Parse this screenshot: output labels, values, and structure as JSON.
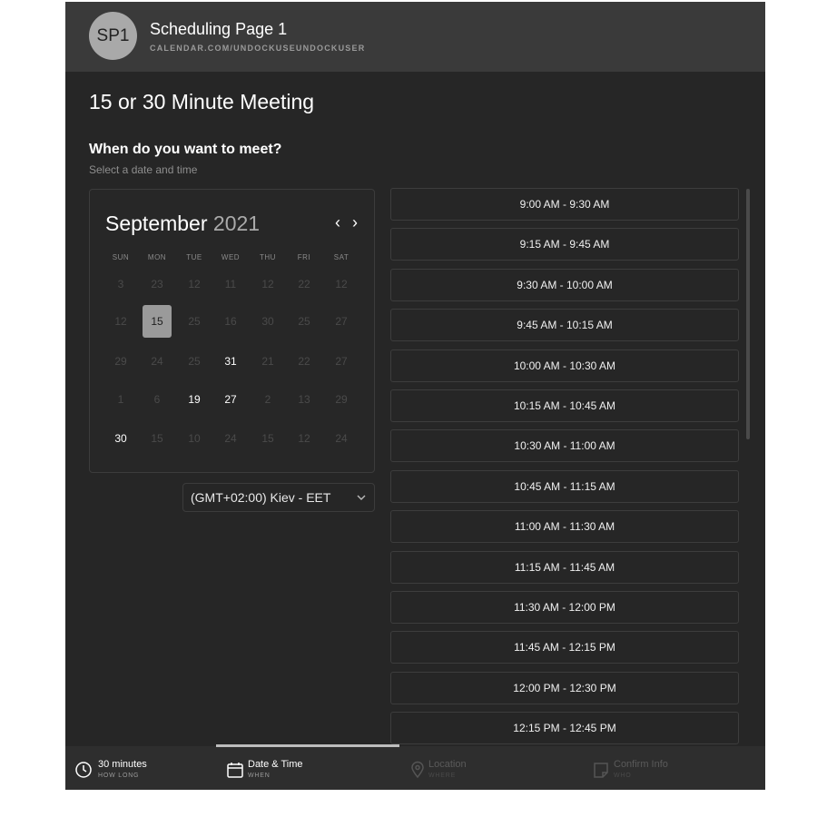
{
  "header": {
    "avatar_text": "SP1",
    "page_name": "Scheduling Page 1",
    "page_url": "CALENDAR.COM/UNDOCKUSEUNDOCKUSER"
  },
  "meeting_title": "15 or 30 Minute Meeting",
  "question": "When do you want to meet?",
  "subquestion": "Select a date and time",
  "calendar": {
    "month": "September",
    "year": "2021",
    "prev_icon": "‹",
    "next_icon": "›",
    "weekdays": [
      "SUN",
      "MON",
      "TUE",
      "WED",
      "THU",
      "FRI",
      "SAT"
    ],
    "weeks": [
      [
        "3",
        "23",
        "12",
        "11",
        "12",
        "22",
        "12"
      ],
      [
        "12",
        "15",
        "25",
        "16",
        "30",
        "25",
        "27"
      ],
      [
        "29",
        "24",
        "25",
        "31",
        "21",
        "22",
        "27"
      ],
      [
        "1",
        "6",
        "19",
        "27",
        "2",
        "13",
        "29"
      ],
      [
        "30",
        "15",
        "10",
        "24",
        "15",
        "12",
        "24"
      ]
    ],
    "selected_day": "15"
  },
  "timezone": {
    "value": "(GMT+02:00) Kiev - EET",
    "chevron": "⌄"
  },
  "time_slots": [
    "9:00 AM - 9:30 AM",
    "9:15 AM - 9:45 AM",
    "9:30 AM - 10:00 AM",
    "9:45 AM - 10:15 AM",
    "10:00 AM - 10:30 AM",
    "10:15 AM - 10:45 AM",
    "10:30 AM - 11:00 AM",
    "10:45 AM - 11:15 AM",
    "11:00 AM - 11:30 AM",
    "11:15 AM - 11:45 AM",
    "11:30 AM - 12:00 PM",
    "11:45 AM - 12:15 PM",
    "12:00 PM - 12:30 PM",
    "12:15 PM - 12:45 PM"
  ],
  "steps": [
    {
      "label": "30 minutes",
      "sub": "HOW LONG",
      "icon": "clock-icon"
    },
    {
      "label": "Date & Time",
      "sub": "WHEN",
      "icon": "calendar-icon"
    },
    {
      "label": "Location",
      "sub": "WHERE",
      "icon": "location-pin-icon"
    },
    {
      "label": "Confirm Info",
      "sub": "WHO",
      "icon": "note-icon"
    }
  ],
  "colors": {
    "background": "#262626",
    "header": "#3a3a3a",
    "selected_day": "#9a9a9a",
    "text": "#ffffff"
  }
}
